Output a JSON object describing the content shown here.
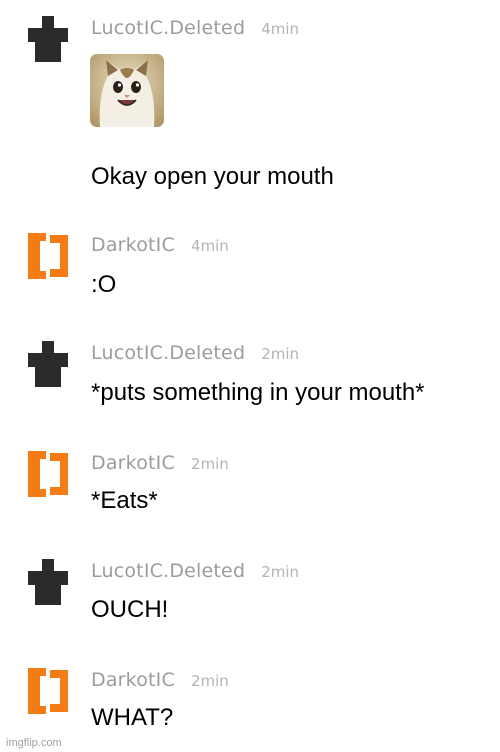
{
  "colors": {
    "background": "#ffffff",
    "username": "#9c9c9c",
    "timestamp": "#b4b4b4",
    "message_text": "#000000",
    "avatar_dark": "#2b2b2b",
    "avatar_orange": "#f57c14"
  },
  "messages": [
    {
      "username": "LucotIC.Deleted",
      "time": "4min",
      "avatar_icon": "dark-shirt-avatar-icon",
      "image": "smiling-cat-thumbnail",
      "text": "Okay open your mouth"
    },
    {
      "username": "DarkotIC",
      "time": "4min",
      "avatar_icon": "orange-bracket-avatar-icon",
      "text": ":O"
    },
    {
      "username": "LucotIC.Deleted",
      "time": "2min",
      "avatar_icon": "dark-shirt-avatar-icon",
      "text": "*puts something in your mouth*"
    },
    {
      "username": "DarkotIC",
      "time": "2min",
      "avatar_icon": "orange-bracket-avatar-icon",
      "text": "*Eats*"
    },
    {
      "username": "LucotIC.Deleted",
      "time": "2min",
      "avatar_icon": "dark-shirt-avatar-icon",
      "text": "OUCH!"
    },
    {
      "username": "DarkotIC",
      "time": "2min",
      "avatar_icon": "orange-bracket-avatar-icon",
      "text": "WHAT?"
    }
  ],
  "watermark": "imgflip.com"
}
